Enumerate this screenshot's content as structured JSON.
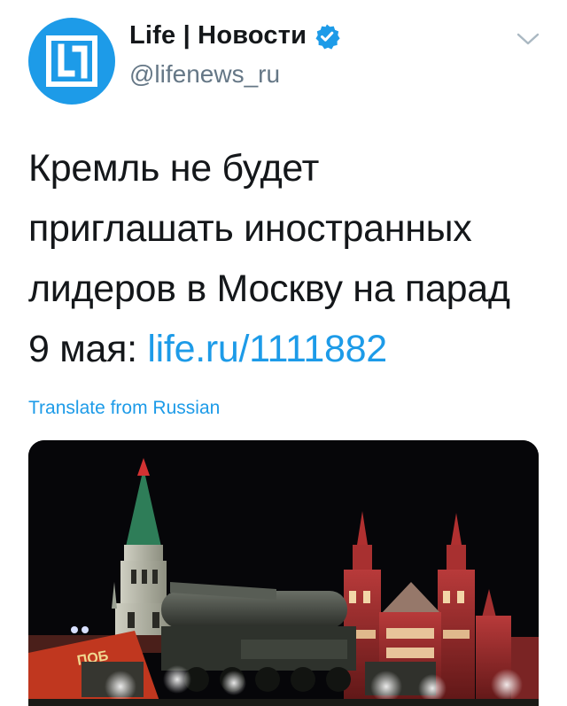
{
  "account": {
    "display_name": "Life | Новости",
    "handle": "@lifenews_ru",
    "verified": true,
    "avatar_icon": "life-logo-icon",
    "avatar_color": "#1d9be8"
  },
  "menu": {
    "icon": "chevron-down-icon"
  },
  "tweet": {
    "lines": [
      "Кремль не будет",
      "приглашать иностранных",
      "лидеров в Москву на парад"
    ],
    "last_line_prefix": "9 мая: ",
    "link_text": "life.ru/1111882",
    "link_color": "#1d9be8"
  },
  "translate_label": "Translate from Russian",
  "media": {
    "description_icon": "red-square-night-photo",
    "banner_text": "ПОБ"
  }
}
